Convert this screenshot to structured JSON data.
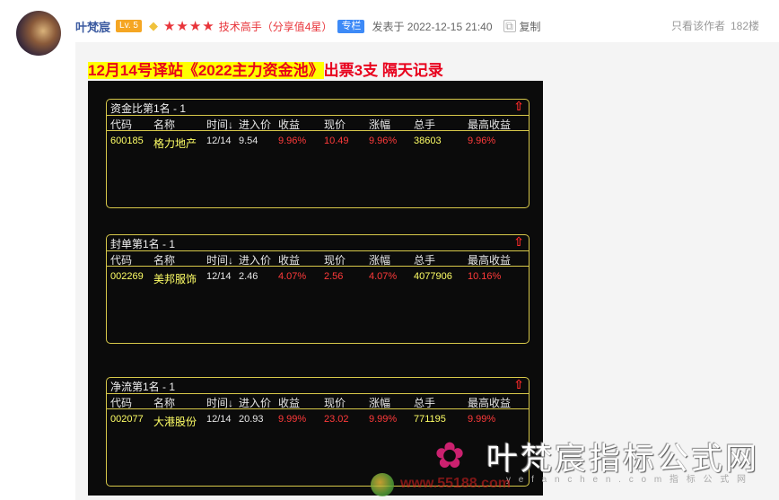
{
  "post": {
    "username": "叶梵宸",
    "level": "Lv. 5",
    "stars": "★★★★",
    "rank_text": "技术高手（分享值4星）",
    "column_badge": "专栏",
    "date": "发表于 2022-12-15 21:40",
    "copy_label": "复制",
    "only_author": "只看该作者",
    "views": "182楼"
  },
  "content": {
    "title_highlight": "12月14号译站《2022主力资金池》",
    "title_rest": "出票3支 隔天记录",
    "headers": [
      "代码",
      "名称",
      "时间↓",
      "进入价",
      "收益",
      "现价",
      "涨幅",
      "总手",
      "最高收益"
    ],
    "panels": [
      {
        "title": "资金比第1名 - 1",
        "row": {
          "code": "600185",
          "name": "格力地产",
          "time": "12/14",
          "entry": "9.54",
          "gain": "9.96%",
          "price": "10.49",
          "change": "9.96%",
          "volume": "38603",
          "max_gain": "9.96%"
        }
      },
      {
        "title": "封单第1名 - 1",
        "row": {
          "code": "002269",
          "name": "美邦服饰",
          "time": "12/14",
          "entry": "2.46",
          "gain": "4.07%",
          "price": "2.56",
          "change": "4.07%",
          "volume": "4077906",
          "max_gain": "10.16%"
        }
      },
      {
        "title": "净流第1名 - 1",
        "row": {
          "code": "002077",
          "name": "大港股份",
          "time": "12/14",
          "entry": "20.93",
          "gain": "9.99%",
          "price": "23.02",
          "change": "9.99%",
          "volume": "771195",
          "max_gain": "9.99%"
        }
      }
    ]
  },
  "watermark": {
    "main": "叶梵宸指标公式网",
    "sub": "y e f a n c h e n . c o m   指 标 公 式 网",
    "secondary": "www.55188.com"
  },
  "colors": {
    "accent_red": "#e8001c",
    "highlight": "#ffff00",
    "panel_border": "#d8c94a",
    "badge_blue": "#3d8af7",
    "level_orange": "#f5a623"
  }
}
